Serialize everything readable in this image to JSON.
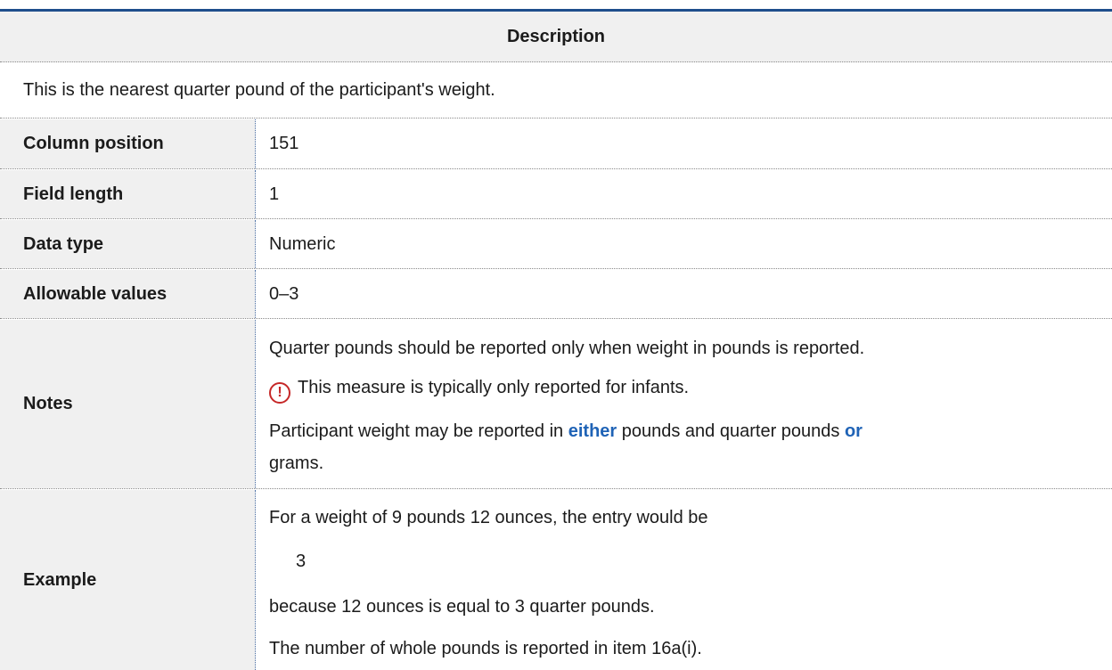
{
  "header": {
    "title": "Description"
  },
  "description": "This is the nearest quarter pound of the participant's weight.",
  "rows": [
    {
      "label": "Column position",
      "value": "151"
    },
    {
      "label": "Field length",
      "value": "1"
    },
    {
      "label": "Data type",
      "value": "Numeric"
    },
    {
      "label": "Allowable values",
      "value": "0–3"
    }
  ],
  "notes": {
    "label": "Notes",
    "line1": "Quarter pounds should be reported only when weight in pounds is reported.",
    "warning_icon": "exclamation-circle-icon",
    "warning_icon_color": "#c62828",
    "line2": "This measure is typically only reported for infants.",
    "line3_prefix": "Participant weight may be reported in ",
    "line3_either": "either",
    "line3_middle": " pounds and quarter pounds ",
    "line3_or": "or",
    "line3_suffix": "grams.",
    "accent_color": "#1f63b6"
  },
  "example": {
    "label": "Example",
    "line1": "For a weight of 9 pounds 12 ounces, the entry would be",
    "code": "3",
    "line2": "because 12 ounces is equal to 3 quarter pounds.",
    "line3": "The number of whole pounds is reported in item 16a(i)."
  },
  "colors": {
    "header_rule": "#1f4e8c",
    "label_bg": "#f0f0f0"
  }
}
